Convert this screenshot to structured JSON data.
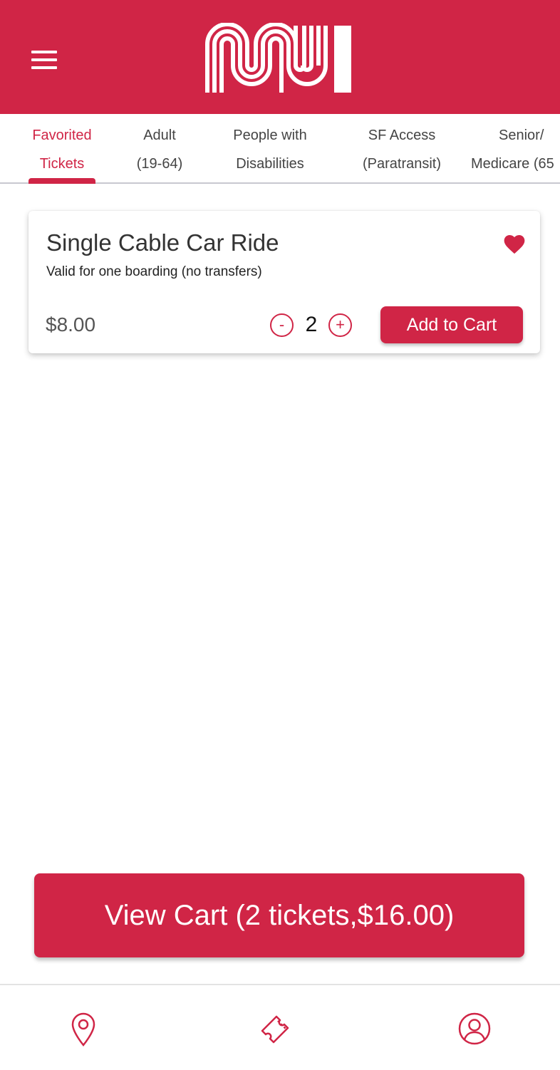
{
  "colors": {
    "brand": "#D02546",
    "header_bg": "#D02546",
    "active_tab": "#D02546",
    "tab_text": "#444444"
  },
  "header": {
    "menu_icon": "hamburger-menu-icon",
    "logo_icon": "muni-logo"
  },
  "tabs": [
    {
      "line1": "Favorited",
      "line2": "Tickets",
      "active": true
    },
    {
      "line1": "Adult",
      "line2": "(19-64)",
      "active": false
    },
    {
      "line1": "People with",
      "line2": "Disabilities",
      "active": false
    },
    {
      "line1": "SF Access",
      "line2": "(Paratransit)",
      "active": false
    },
    {
      "line1": "Senior/",
      "line2": "Medicare (65",
      "active": false
    }
  ],
  "ticket": {
    "title": "Single Cable Car Ride",
    "description": "Valid for one boarding (no transfers)",
    "price": "$8.00",
    "quantity": "2",
    "minus_label": "-",
    "plus_label": "+",
    "add_label": "Add to Cart",
    "favorite_icon": "heart-icon"
  },
  "cart": {
    "label": "View Cart (2 tickets,$16.00)"
  },
  "bottom_nav": [
    "location-pin-icon",
    "ticket-icon",
    "account-icon"
  ]
}
